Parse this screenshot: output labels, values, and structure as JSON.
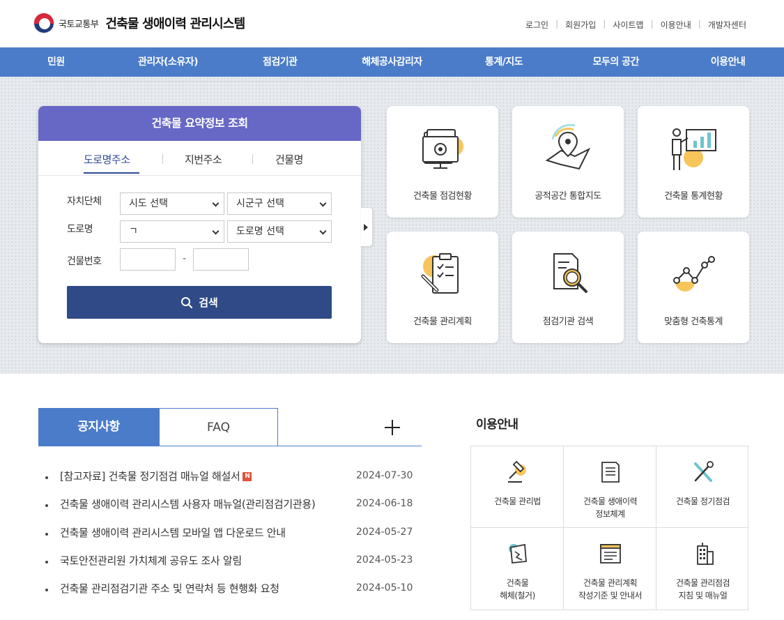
{
  "header": {
    "ministry": "국토교통부",
    "site_title": "건축물 생애이력 관리시스템",
    "util_links": [
      "로그인",
      "회원가입",
      "사이트맵",
      "이용안내",
      "개발자센터"
    ]
  },
  "nav": {
    "items": [
      "민원",
      "관리자(소유자)",
      "점검기관",
      "해체공사감리자",
      "통계/지도",
      "모두의 공간",
      "이용안내"
    ]
  },
  "search_panel": {
    "title": "건축물 요약정보 조회",
    "tabs": [
      "도로명주소",
      "지번주소",
      "건물명"
    ],
    "labels": {
      "region": "자치단체",
      "road": "도로명",
      "building_no": "건물번호"
    },
    "selects": {
      "sido": "시도 선택",
      "sigungu": "시군구 선택",
      "initial": "ㄱ",
      "road_name": "도로명 선택"
    },
    "dash": "-",
    "search_label": "검색"
  },
  "cards": [
    {
      "label": "건축물 점검현황",
      "icon": "inspection-monitor-icon"
    },
    {
      "label": "공적공간 통합지도",
      "icon": "map-pin-icon"
    },
    {
      "label": "건축물 통계현황",
      "icon": "presentation-chart-icon"
    },
    {
      "label": "건축물 관리계획",
      "icon": "clipboard-checklist-icon"
    },
    {
      "label": "점검기관 검색",
      "icon": "document-search-icon"
    },
    {
      "label": "맞춤형 건축통계",
      "icon": "line-graph-icon"
    }
  ],
  "notices": {
    "tab_notice": "공지사항",
    "tab_faq": "FAQ",
    "new_badge": "N",
    "items": [
      {
        "title": "[참고자료] 건축물 정기점검 매뉴얼 해설서",
        "date": "2024-07-30",
        "is_new": true
      },
      {
        "title": "건축물 생애이력 관리시스템 사용자 매뉴얼(관리점검기관용)",
        "date": "2024-06-18",
        "is_new": false
      },
      {
        "title": "건축물 생애이력 관리시스템 모바일 앱 다운로드 안내",
        "date": "2024-05-27",
        "is_new": false
      },
      {
        "title": "국토안전관리원 가치체계 공유도 조사 알림",
        "date": "2024-05-23",
        "is_new": false
      },
      {
        "title": "건축물 관리점검기관 주소 및 연락처 등 현행화 요청",
        "date": "2024-05-10",
        "is_new": false
      }
    ]
  },
  "guide": {
    "title": "이용안내",
    "items": [
      {
        "line1": "건축물 관리법",
        "line2": "",
        "icon": "gavel-icon"
      },
      {
        "line1": "건축물 생애이력",
        "line2": "정보체계",
        "icon": "document-icon"
      },
      {
        "line1": "건축물 정기점검",
        "line2": "",
        "icon": "tools-icon"
      },
      {
        "line1": "건축물",
        "line2": "해체(철거)",
        "icon": "broken-building-icon"
      },
      {
        "line1": "건축물 관리계획",
        "line2": "작성기준 및 안내서",
        "icon": "window-doc-icon"
      },
      {
        "line1": "건축물 관리점검",
        "line2": "지침 및 매뉴얼",
        "icon": "building-icon"
      }
    ]
  },
  "colors": {
    "nav": "#4a7cc9",
    "panel_head": "#6767c6",
    "search_button": "#2f4a86",
    "icon_accent": "#f8c55a"
  }
}
